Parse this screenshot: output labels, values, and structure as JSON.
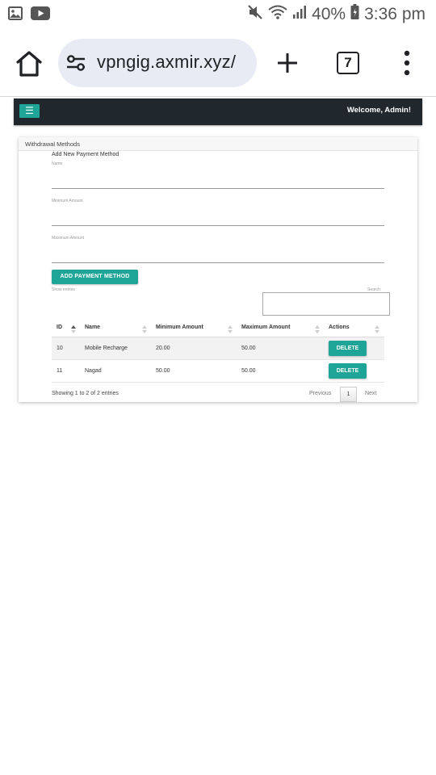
{
  "status_bar": {
    "battery": "40%",
    "time": "3:36 pm",
    "icons": [
      "gallery-icon",
      "youtube-icon",
      "mute-icon",
      "wifi-icon",
      "signal-icon",
      "battery-icon"
    ]
  },
  "browser": {
    "url": "vpngig.axmir.xyz/",
    "tab_count": "7",
    "icons": [
      "home-icon",
      "site-settings-icon",
      "new-tab-icon",
      "tab-switcher-icon",
      "more-icon"
    ]
  },
  "navbar": {
    "toggle_label": "☰",
    "welcome": "Welcome, Admin!"
  },
  "card": {
    "title": "Withdrawal Methods",
    "form_title": "Add New Payment Method",
    "fields": [
      {
        "label": "Name",
        "value": ""
      },
      {
        "label": "Minimum Amount",
        "value": ""
      },
      {
        "label": "Maximum Amount",
        "value": ""
      }
    ],
    "submit_label": "ADD PAYMENT METHOD",
    "show_entries": "Show entries",
    "search_label": "Search:",
    "table": {
      "headers": [
        "ID",
        "Name",
        "Minimum Amount",
        "Maximum Amount",
        "Actions"
      ],
      "rows": [
        {
          "id": "10",
          "name": "Mobile Recharge",
          "min": "20.00",
          "max": "50.00",
          "action": "DELETE"
        },
        {
          "id": "11",
          "name": "Nagad",
          "min": "50.00",
          "max": "50.00",
          "action": "DELETE"
        }
      ]
    },
    "info": "Showing 1 to 2 of 2 entries",
    "pagination": {
      "previous": "Previous",
      "current": "1",
      "next": "Next"
    }
  },
  "colors": {
    "accent": "#1fa597",
    "navbar": "#20272d",
    "url_pill": "#e8ebf4"
  }
}
